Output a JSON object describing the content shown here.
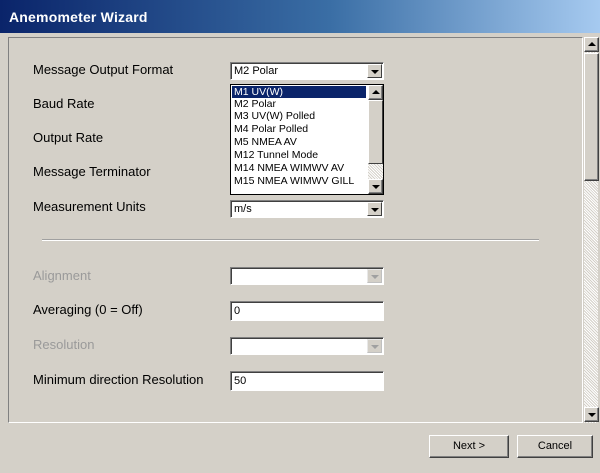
{
  "window": {
    "title": "Anemometer Wizard"
  },
  "form": {
    "message_output_format": {
      "label": "Message Output Format",
      "value": "M2 Polar"
    },
    "baud_rate": {
      "label": "Baud Rate"
    },
    "output_rate": {
      "label": "Output Rate"
    },
    "message_terminator": {
      "label": "Message Terminator"
    },
    "measurement_units": {
      "label": "Measurement Units",
      "value": "m/s"
    },
    "alignment": {
      "label": "Alignment",
      "value": "",
      "disabled": true
    },
    "averaging": {
      "label": "Averaging (0 = Off)",
      "value": "0"
    },
    "resolution": {
      "label": "Resolution",
      "value": "",
      "disabled": true
    },
    "minimum_direction_resolution": {
      "label": "Minimum direction Resolution",
      "value": "50"
    }
  },
  "dropdown": {
    "selected": "M1 UV(W)",
    "options": [
      "M1 UV(W)",
      "M2 Polar",
      "M3 UV(W) Polled",
      "M4 Polar Polled",
      "M5 NMEA AV",
      "M12 Tunnel Mode",
      "M14 NMEA WIMWV AV",
      "M15 NMEA WIMWV GILL"
    ]
  },
  "buttons": {
    "next": "Next >",
    "cancel": "Cancel"
  },
  "icons": {
    "scroll_up": "up-arrow-icon",
    "scroll_down": "down-arrow-icon",
    "dropdown": "chevron-down-icon"
  },
  "colors": {
    "title_start": "#0a246a",
    "title_end": "#a6caf0",
    "face": "#d4d0c8",
    "selection": "#0a246a"
  }
}
